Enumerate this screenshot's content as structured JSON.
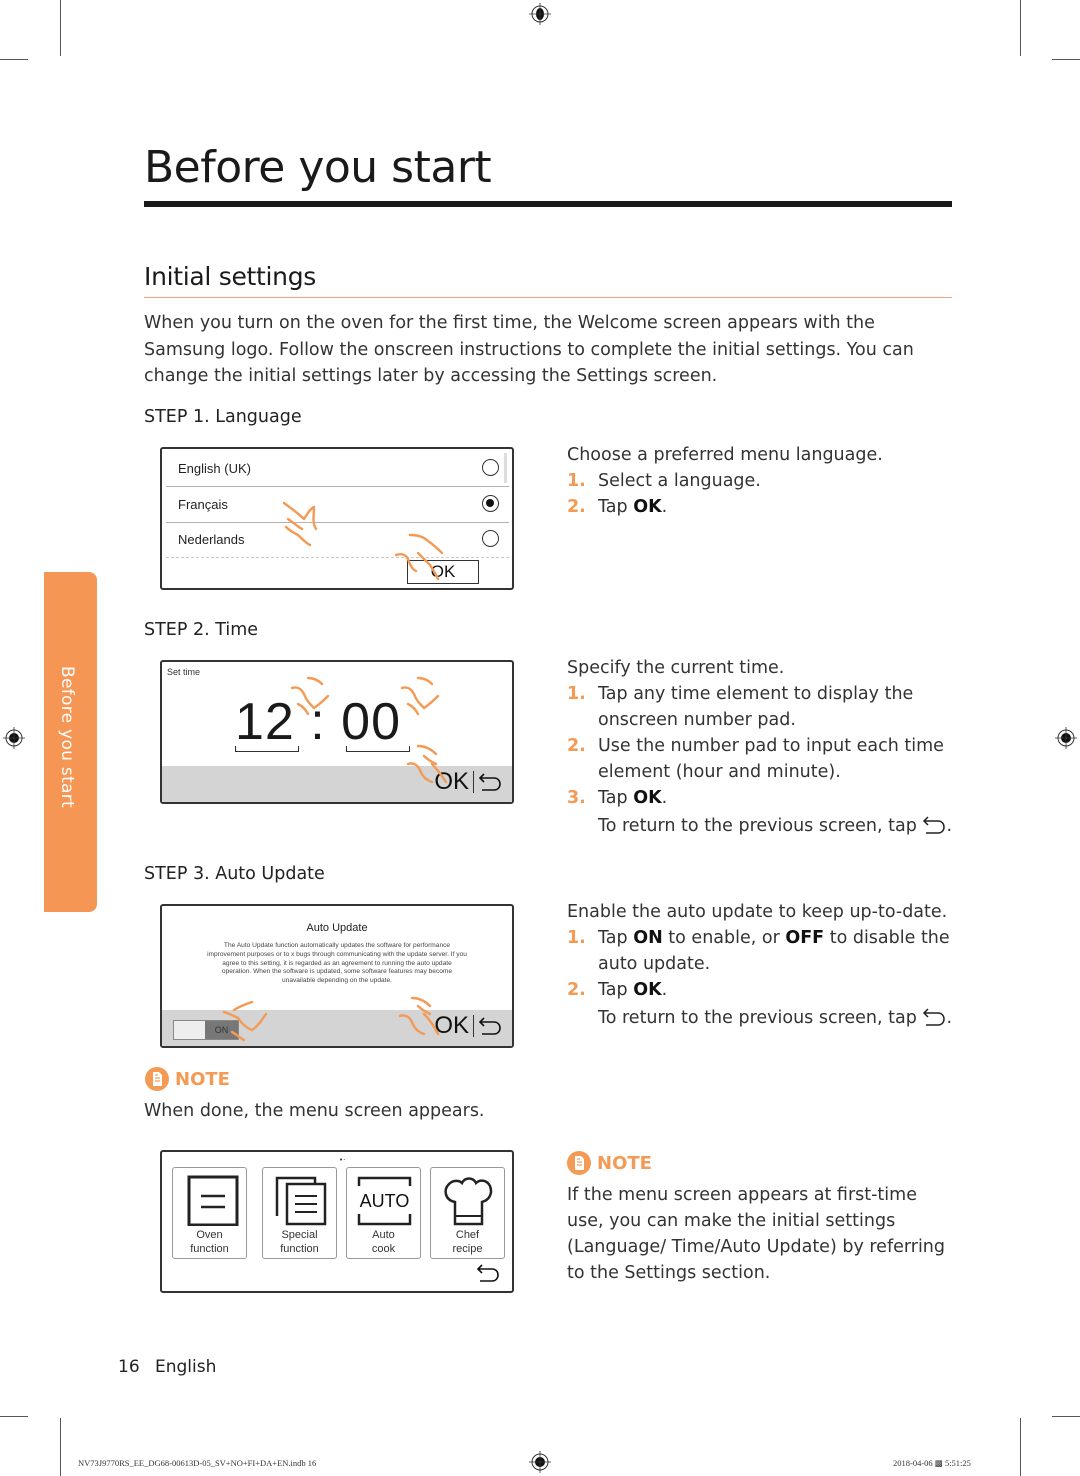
{
  "page": {
    "title": "Before you start",
    "section_title": "Initial settings",
    "intro": "When you turn on the oven for the first time, the Welcome screen appears with the Samsung logo. Follow the onscreen instructions to complete the initial settings. You can change the initial settings later by accessing the Settings screen.",
    "side_tab": "Before you start",
    "accent_color": "#f39a54"
  },
  "step1": {
    "label": "STEP 1. Language",
    "screen": {
      "languages": [
        {
          "name": "English (UK)",
          "selected": false
        },
        {
          "name": "Français",
          "selected": true
        },
        {
          "name": "Nederlands",
          "selected": false
        }
      ],
      "ok_button": "OK"
    },
    "lead": "Choose a preferred menu language.",
    "items": [
      {
        "num": "1.",
        "pre": "Select a language.",
        "bold": "",
        "post": ""
      },
      {
        "num": "2.",
        "pre": "Tap ",
        "bold": "OK",
        "post": "."
      }
    ]
  },
  "step2": {
    "label": "STEP 2. Time",
    "screen": {
      "title": "Set time",
      "time": "12 : 00",
      "ok_button": "OK",
      "back_icon": "back-arrow"
    },
    "lead": "Specify the current time.",
    "items": [
      {
        "num": "1.",
        "pre": "Tap any time element to display the onscreen number pad.",
        "bold": "",
        "post": ""
      },
      {
        "num": "2.",
        "pre": "Use the number pad to input each time element (hour and minute).",
        "bold": "",
        "post": ""
      },
      {
        "num": "3.",
        "pre": "Tap ",
        "bold": "OK",
        "post": "."
      }
    ],
    "sub": "To return to the previous screen, tap"
  },
  "step3": {
    "label": "STEP 3. Auto Update",
    "screen": {
      "title": "Auto Update",
      "body": "The Auto Update function automatically updates the software for performance improvement purposes or to  x bugs through communicating with the update server. If you agree to this setting, it is regarded as an agreement to running the auto update operation. When the software is updated, some software features may become unavailable depending on the update.",
      "toggle_label": "ON",
      "ok_button": "OK",
      "back_icon": "back-arrow"
    },
    "lead": "Enable the auto update to keep up-to-date.",
    "items": [
      {
        "num": "1.",
        "pre": "Tap ",
        "bold": "ON",
        "mid": " to enable, or ",
        "bold2": "OFF",
        "post": " to disable the auto update."
      },
      {
        "num": "2.",
        "pre": "Tap ",
        "bold": "OK",
        "post": "."
      }
    ],
    "sub": "To return to the previous screen, tap"
  },
  "note1": {
    "heading": "NOTE",
    "text": "When done, the menu screen appears."
  },
  "menu_screen": {
    "tiles": [
      {
        "line1": "Oven",
        "line2": "function",
        "icon": "oven-function"
      },
      {
        "line1": "Special",
        "line2": "function",
        "icon": "special-function"
      },
      {
        "line1": "Auto",
        "line2": "cook",
        "icon": "auto-cook",
        "icon_text": "AUTO"
      },
      {
        "line1": "Chef",
        "line2": "recipe",
        "icon": "chef-hat"
      }
    ],
    "back_icon": "back-arrow"
  },
  "note2": {
    "heading": "NOTE",
    "text": "If the menu screen appears at first-time use, you can make the initial settings (Language/ Time/Auto Update) by referring to the Settings section."
  },
  "footer": {
    "page_number": "16",
    "language": "English",
    "slug_file": "NV73J9770RS_EE_DG68-00613D-05_SV+NO+FI+DA+EN.indb   16",
    "slug_date": "2018-04-06   ▩ 5:51:25"
  }
}
